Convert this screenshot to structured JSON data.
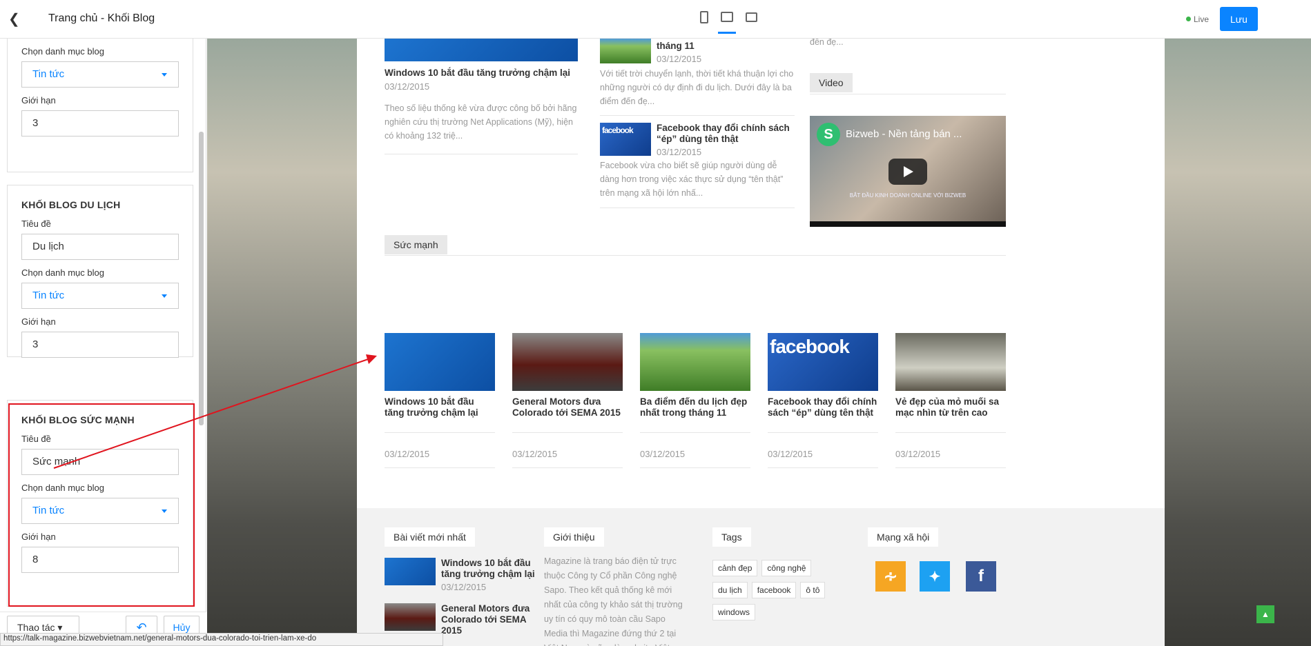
{
  "topbar": {
    "title": "Trang chủ - Khối Blog",
    "live": "Live",
    "save": "Lưu"
  },
  "sidebar": {
    "top_partial": {
      "cat_label": "Chọn danh mục blog",
      "cat_value": "Tin tức",
      "limit_label": "Giới hạn",
      "limit_value": "3"
    },
    "dulich": {
      "heading": "KHỐI BLOG DU LỊCH",
      "title_label": "Tiêu đề",
      "title_value": "Du lịch",
      "cat_label": "Chọn danh mục blog",
      "cat_value": "Tin tức",
      "limit_label": "Giới hạn",
      "limit_value": "3"
    },
    "sucmanh": {
      "heading": "KHỐI BLOG SỨC MẠNH",
      "title_label": "Tiêu đề",
      "title_value": "Sức mạnh",
      "cat_label": "Chọn danh mục blog",
      "cat_value": "Tin tức",
      "limit_label": "Giới hạn",
      "limit_value": "8"
    },
    "actions_label": "Thao tác",
    "undo_icon": "undo-icon",
    "cancel_label": "Hủy"
  },
  "preview": {
    "col1": {
      "title": "Windows 10 bắt đầu tăng trưởng chậm lại",
      "date": "03/12/2015",
      "excerpt": "Theo số liệu thống kê vừa được công bố bởi hãng nghiên cứu thị trường Net Applications (Mỹ), hiện có khoảng 132 triệ..."
    },
    "col2": {
      "partial_title": "tháng 11",
      "partial_date": "03/12/2015",
      "partial_excerpt": "Với tiết trời chuyển lạnh, thời tiết khá thuận lợi cho những người có dự định đi du lịch. Dưới đây là ba điểm đến đẹ...",
      "title": "Facebook thay đổi chính sách “ép” dùng tên thật",
      "date": "03/12/2015",
      "excerpt": "Facebook vừa cho biết sẽ giúp người dùng dễ dàng hơn trong việc xác thực sử dụng “tên thật” trên mạng xã hội lớn nhấ..."
    },
    "col3": {
      "partial_excerpt": "đến đẹ...",
      "video_tab": "Video",
      "video_title": "Bizweb - Nền tảng bán ...",
      "video_caption": "BẮT ĐẦU KINH DOANH ONLINE VỚI BIZWEB"
    },
    "section_tab": "Sức mạnh",
    "cards": [
      {
        "title": "Windows 10 bắt đầu tăng trưởng chậm lại",
        "date": "03/12/2015"
      },
      {
        "title": "General Motors đưa Colorado tới SEMA 2015",
        "date": "03/12/2015"
      },
      {
        "title": "Ba điểm đến du lịch đẹp nhất trong tháng 11",
        "date": "03/12/2015"
      },
      {
        "title": "Facebook thay đổi chính sách “ép” dùng tên thật",
        "date": "03/12/2015"
      },
      {
        "title": "Vẻ đẹp của mỏ muối sa mạc nhìn từ trên cao",
        "date": "03/12/2015"
      }
    ],
    "footer": {
      "latest_tab": "Bài viết mới nhất",
      "latest": [
        {
          "title": "Windows 10 bắt đầu tăng trưởng chậm lại",
          "date": "03/12/2015"
        },
        {
          "title": "General Motors đưa Colorado tới SEMA 2015",
          "date": ""
        }
      ],
      "about_tab": "Giới thiệu",
      "about_text": "Magazine là trang báo điện tử trực thuộc Công ty Cổ phần Công nghệ Sapo. Theo kết quả thống kê mới nhất của công ty khảo sát thị trường uy tín có quy mô toàn cầu Sapo Media thì Magazine đứng thứ 2 tại Việt Nam và cũng là website Việt Nam",
      "tags_tab": "Tags",
      "tags": [
        "cảnh đẹp",
        "công nghệ",
        "du lịch",
        "facebook",
        "ô tô",
        "windows"
      ],
      "social_tab": "Mạng xã hội"
    }
  },
  "status_url": "https://talk-magazine.bizwebvietnam.net/general-motors-dua-colorado-toi-trien-lam-xe-do",
  "colors": {
    "accent": "#0a84ff",
    "highlight": "#e0141e",
    "rss": "#f6a623",
    "twitter": "#1da1f2",
    "facebook": "#3b5998"
  }
}
